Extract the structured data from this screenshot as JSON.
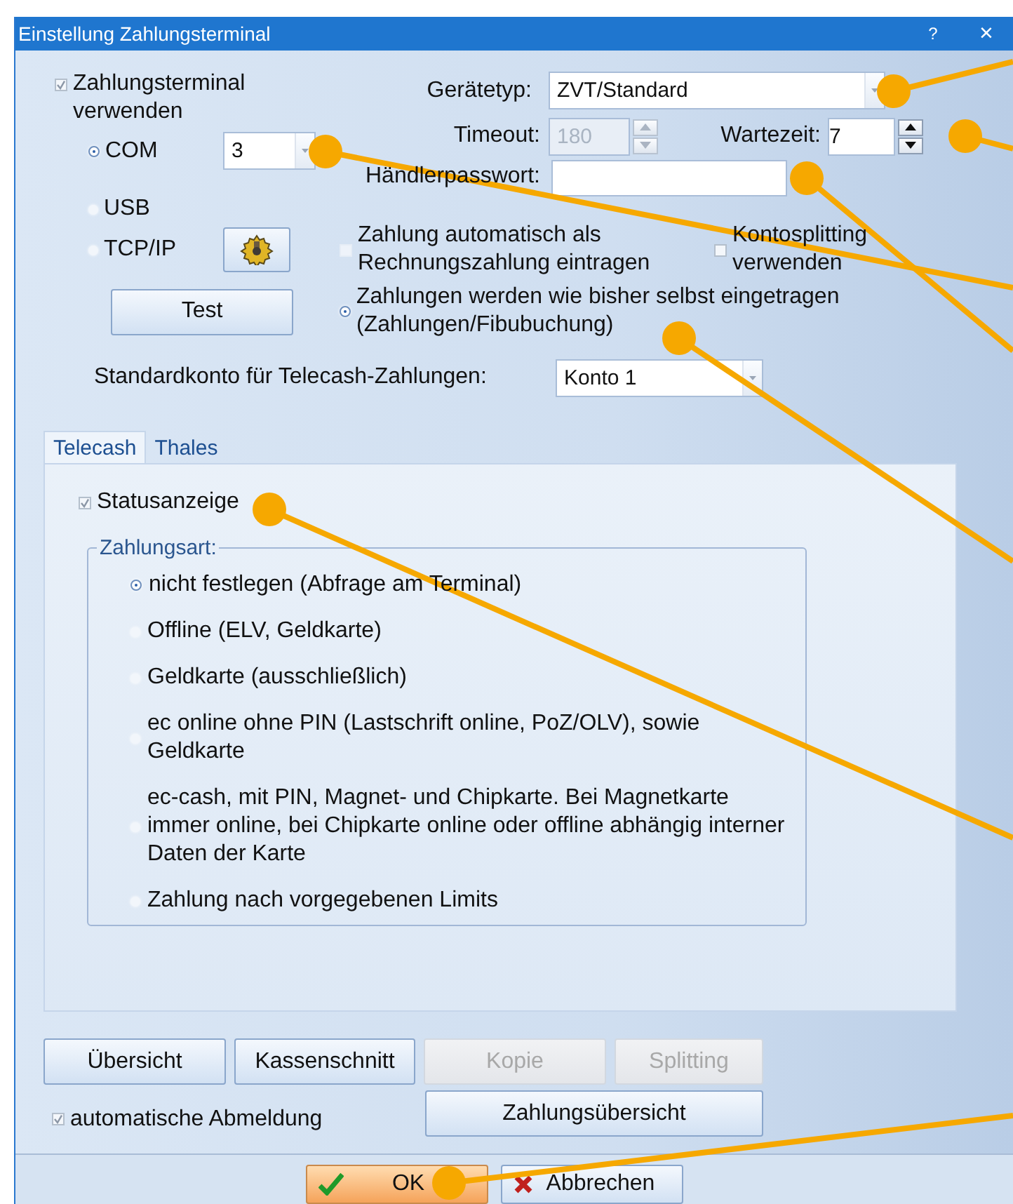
{
  "window": {
    "title": "Einstellung Zahlungsterminal",
    "help_button": "?",
    "close_button": "×"
  },
  "use_terminal": {
    "label": "Zahlungsterminal verwenden",
    "checked": true
  },
  "device_type": {
    "label": "Gerätetyp:",
    "value": "ZVT/Standard"
  },
  "connections": [
    {
      "label": "COM",
      "selected": true
    },
    {
      "label": "USB",
      "selected": false
    },
    {
      "label": "TCP/IP",
      "selected": false
    }
  ],
  "com_port": {
    "value": "3"
  },
  "timeout": {
    "label": "Timeout:",
    "value": "180",
    "disabled": true
  },
  "wait_time": {
    "label": "Wartezeit:",
    "value": "7",
    "disabled": false
  },
  "merchant_password": {
    "label": "Händlerpasswort:"
  },
  "auto_invoice_payment": {
    "label": "Zahlung automatisch als\nRechnungszahlung eintragen",
    "checked": false
  },
  "account_splitting": {
    "label": "Kontosplitting\nverwenden",
    "checked": false
  },
  "test_button": "Test",
  "manual_payments": {
    "label": "Zahlungen werden wie bisher selbst eingetragen\n(Zahlungen/Fibubuchung)",
    "selected": true
  },
  "default_account": {
    "label": "Standardkonto für Telecash-Zahlungen:",
    "value": "Konto 1"
  },
  "tabs": [
    {
      "label": "Telecash",
      "selected": true
    },
    {
      "label": "Thales",
      "selected": false
    }
  ],
  "status_display": {
    "label": "Statusanzeige",
    "checked": true
  },
  "payment_type": {
    "legend": "Zahlungsart:",
    "options": [
      {
        "label": "nicht festlegen (Abfrage am Terminal)",
        "selected": true
      },
      {
        "label": "Offline (ELV, Geldkarte)",
        "selected": false
      },
      {
        "label": "Geldkarte (ausschließlich)",
        "selected": false
      },
      {
        "label": "ec online ohne PIN (Lastschrift online, PoZ/OLV), sowie\nGeldkarte",
        "selected": false
      },
      {
        "label": "ec-cash, mit PIN, Magnet- und Chipkarte. Bei Magnetkarte\nimmer online, bei Chipkarte online oder offline abhängig interner\nDaten der Karte",
        "selected": false
      },
      {
        "label": "Zahlung nach vorgegebenen Limits",
        "selected": false
      }
    ]
  },
  "buttons": [
    {
      "label": "Übersicht",
      "disabled": false
    },
    {
      "label": "Kassenschnitt",
      "disabled": false
    },
    {
      "label": "Kopie",
      "disabled": true
    },
    {
      "label": "Splitting",
      "disabled": true
    }
  ],
  "auto_logout": {
    "label": "automatische Abmeldung",
    "checked": true
  },
  "payment_overview_button": "Zahlungsübersicht",
  "footer_buttons": [
    {
      "label": "OK",
      "kind": "ok"
    },
    {
      "label": "Abbrechen",
      "kind": "cancel"
    }
  ]
}
